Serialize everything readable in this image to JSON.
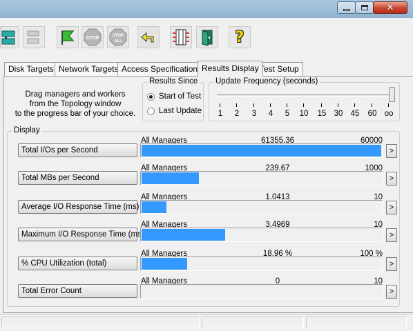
{
  "colors": {
    "bar": "#3399ff",
    "titlebar": "#9dbcd6",
    "close": "#c8452f"
  },
  "window": {
    "controls": [
      "minimize-icon",
      "maximize-icon",
      "close-icon"
    ],
    "close_glyph": "✕"
  },
  "toolbar": {
    "icons": [
      "topology-icon",
      "disconnect-icon",
      "start-tests-icon",
      "stop-icon",
      "stop-all-icon",
      "reset-workers-icon",
      "new-manager-icon",
      "exit-icon",
      "help-icon"
    ],
    "stop_label": "STOP",
    "stop_all_label": "STOP ALL",
    "help_glyph": "?"
  },
  "tabs": [
    "Disk Targets",
    "Network Targets",
    "Access Specifications",
    "Results Display",
    "Test Setup"
  ],
  "active_tab": "Results Display",
  "help_text": {
    "line1": "Drag managers and workers",
    "line2": "from the Topology window",
    "line3": "to the progress bar of your choice."
  },
  "results_since": {
    "title": "Results Since",
    "options": [
      "Start of Test",
      "Last Update"
    ],
    "selected": "Start of Test"
  },
  "update_frequency": {
    "title": "Update Frequency (seconds)",
    "ticks": [
      "1",
      "2",
      "3",
      "4",
      "5",
      "10",
      "15",
      "30",
      "45",
      "60",
      "oo"
    ],
    "selected": "oo"
  },
  "display": {
    "title": "Display",
    "more_label": ">",
    "rows": [
      {
        "button": "Total I/Os per Second",
        "source": "All Managers",
        "value": "61355.36",
        "max": "60000",
        "fill": 1.0
      },
      {
        "button": "Total MBs per Second",
        "source": "All Managers",
        "value": "239.67",
        "max": "1000",
        "fill": 0.24
      },
      {
        "button": "Average I/O Response Time (ms)",
        "source": "All Managers",
        "value": "1.0413",
        "max": "10",
        "fill": 0.104
      },
      {
        "button": "Maximum I/O Response Time (ms)",
        "source": "All Managers",
        "value": "3.4969",
        "max": "10",
        "fill": 0.35
      },
      {
        "button": "% CPU Utilization (total)",
        "source": "All Managers",
        "value": "18.96 %",
        "max": "100 %",
        "fill": 0.19
      },
      {
        "button": "Total Error Count",
        "source": "All Managers",
        "value": "0",
        "max": "10",
        "fill": 0
      }
    ]
  }
}
